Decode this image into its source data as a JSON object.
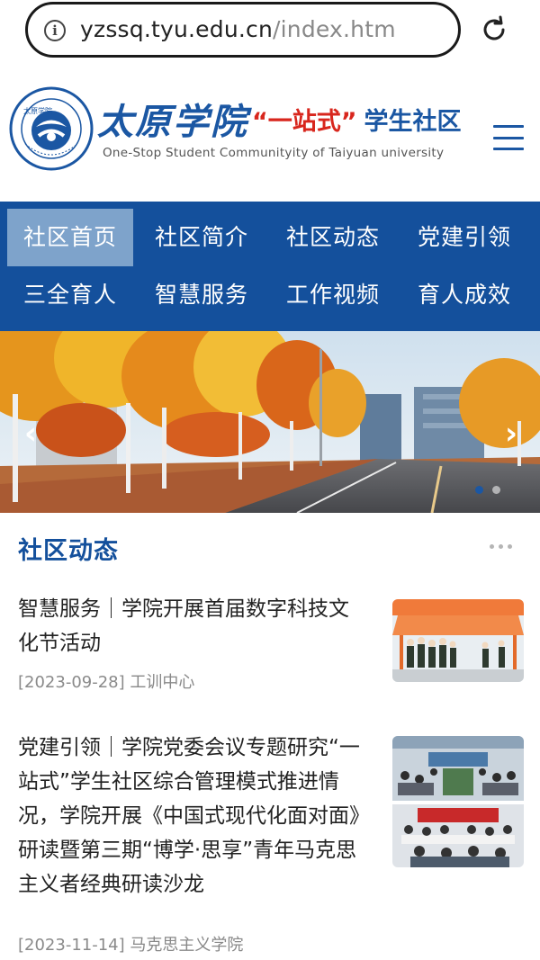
{
  "browser": {
    "url_host": "yzssq.tyu.edu.cn",
    "url_path": "/index.htm"
  },
  "header": {
    "school_name": "太原学院",
    "slogan_quote": "“一站式”",
    "slogan_rest": "学生社区",
    "subtitle": "One-Stop Student Communityity of Taiyuan university",
    "emblem_text": "TAIYUAN UNIVERSITY"
  },
  "nav": {
    "items": [
      {
        "label": "社区首页",
        "active": true
      },
      {
        "label": "社区简介",
        "active": false
      },
      {
        "label": "社区动态",
        "active": false
      },
      {
        "label": "党建引领",
        "active": false
      },
      {
        "label": "三全育人",
        "active": false
      },
      {
        "label": "智慧服务",
        "active": false
      },
      {
        "label": "工作视频",
        "active": false
      },
      {
        "label": "育人成效",
        "active": false
      }
    ]
  },
  "banner": {
    "prev_glyph": "‹",
    "next_glyph": "›",
    "slide_count": 2,
    "active_slide": 1
  },
  "news": {
    "section_title": "社区动态",
    "items": [
      {
        "title": "智慧服务｜学院开展首届数字科技文化节活动",
        "date": "[2023-09-28]",
        "source": "工训中心"
      },
      {
        "title": "党建引领｜学院党委会议专题研究“一站式”学生社区综合管理模式推进情况，学院开展《中国式现代化面对面》研读暨第三期“博学·思享”青年马克思主义者经典研读沙龙",
        "date": "[2023-11-14]",
        "source": "马克思主义学院"
      }
    ]
  },
  "colors": {
    "brand_blue": "#14509c",
    "brand_red": "#d8261d",
    "nav_active": "#7ea3cb"
  }
}
